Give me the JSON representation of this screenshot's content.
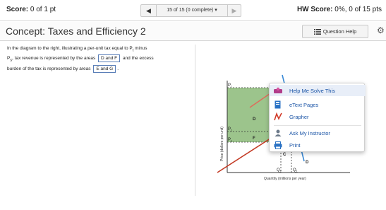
{
  "header": {
    "score_label": "Score:",
    "score_value": "0 of 1 pt",
    "nav_prev_icon": "left-arrow-icon",
    "nav_status": "15 of 15 (0 complete) ▾",
    "nav_next_icon": "right-arrow-icon",
    "hw_label": "HW Score:",
    "hw_value": "0%, 0 of 15 pts"
  },
  "titlebar": {
    "title": "Concept: Taxes and Efficiency 2",
    "question_help": "Question Help",
    "settings_icon": "gear-icon"
  },
  "question": {
    "line1": "In the diagram to the right, illustrating a per-unit tax equal to P",
    "sub_t": "t",
    "line1b": " minus",
    "p_s": "P",
    "sub_s": "s",
    "line2": ", tax revenue is represented by the areas",
    "answer1": "D and F",
    "line2b": "and the excess",
    "line3": "burden of the tax is represented by areas",
    "answer2": "E and G",
    "period": "."
  },
  "menu": {
    "items": [
      {
        "label": "Help Me Solve This",
        "icon": "help-solve-icon"
      },
      {
        "label": "eText Pages",
        "icon": "etext-book-icon"
      },
      {
        "label": "Grapher",
        "icon": "grapher-icon"
      },
      {
        "label": "Ask My Instructor",
        "icon": "instructor-icon"
      },
      {
        "label": "Print",
        "icon": "printer-icon"
      }
    ]
  },
  "graph": {
    "y_axis_label": "Price (dollars per unit)",
    "x_axis_label": "Quantity (millions per year)",
    "price_labels": [
      "P",
      "P",
      "P"
    ],
    "price_subs": [
      "t",
      "1",
      "s"
    ],
    "qty_labels": [
      "Q",
      "Q"
    ],
    "qty_subs": [
      "2",
      "1"
    ],
    "areas": [
      "D",
      "E",
      "F",
      "G",
      "C"
    ],
    "point_label": "A",
    "supply_label": "S",
    "supply_sub": "1",
    "demand_label": "D",
    "colors": {
      "green_area": "#9cc48c",
      "yellow_area": "#f6ec72",
      "supply_line": "#c33a24",
      "demand_line": "#3a8ad6",
      "tax_line": "#e06a5a"
    }
  }
}
